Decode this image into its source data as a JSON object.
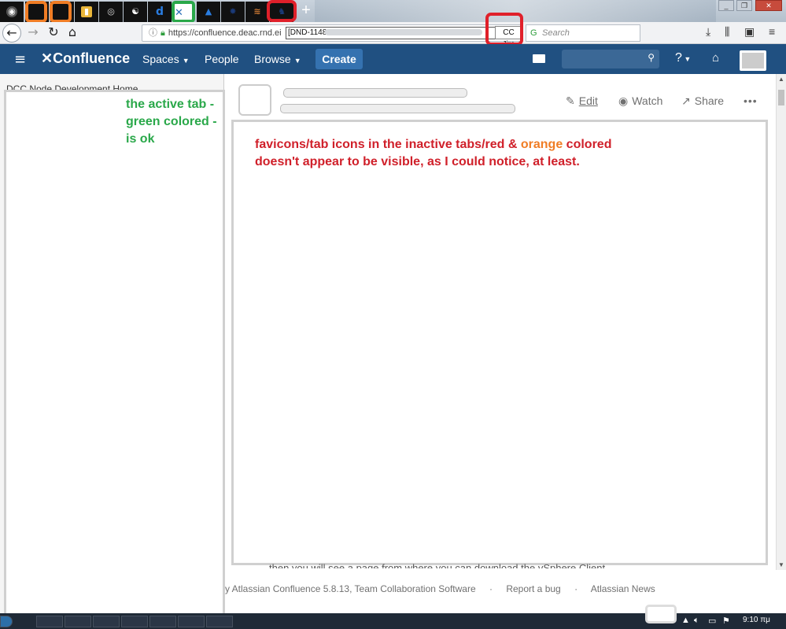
{
  "browser": {
    "url": "https://confluence.deac.rnd.ei",
    "url_overlay_title": "[DND-1148",
    "jira_pill": "CC Jira",
    "search_placeholder": "Search",
    "tabs": [
      {
        "icon": "globe-icon",
        "glyph": "◉",
        "color": "#9aa"
      },
      {
        "icon": "blank-tab-icon",
        "glyph": "",
        "color": "#111"
      },
      {
        "icon": "blank-tab-icon",
        "glyph": "",
        "color": "#111"
      },
      {
        "icon": "trello-icon",
        "glyph": "▮",
        "color": "#e9b63a"
      },
      {
        "icon": "swirl-icon",
        "glyph": "◎",
        "color": "#ddd"
      },
      {
        "icon": "yin-yang-icon",
        "glyph": "☯",
        "color": "#fff"
      },
      {
        "icon": "d-logo-icon",
        "glyph": "d",
        "color": "#2a7de1"
      },
      {
        "icon": "confluence-icon",
        "glyph": "✕",
        "color": "#2a6fb8"
      },
      {
        "icon": "atlassian-icon",
        "glyph": "▲",
        "color": "#2a7de1"
      },
      {
        "icon": "jira-dark-icon",
        "glyph": "✸",
        "color": "#1b3a78"
      },
      {
        "icon": "stack-icon",
        "glyph": "≋",
        "color": "#d07b34"
      },
      {
        "icon": "jira-icon",
        "glyph": "♞",
        "color": "#1b3a78"
      }
    ]
  },
  "confluence": {
    "logo": "✕Confluence",
    "menu": {
      "spaces": "Spaces",
      "people": "People",
      "browse": "Browse"
    },
    "create": "Create",
    "sidebar_crumb": "DCC Node Development Home",
    "actions": {
      "edit": "Edit",
      "watch": "Watch",
      "share": "Share",
      "more": "•••"
    },
    "body_text": "then you will see a page from where you can download the vSphere Client",
    "footer": {
      "powered": "y Atlassian Confluence 5.8.13, Team Collaboration Software",
      "sep": "·",
      "report": "Report a bug",
      "news": "Atlassian News"
    }
  },
  "annotations": {
    "green_note": "the active tab - green colored - is ok",
    "red_note_part1": "favicons/tab icons in the inactive tabs/red &",
    "red_note_orange": "orange",
    "red_note_part2": "colored doesn't appear to be visible, as I could notice, at least."
  },
  "taskbar": {
    "clock": "9:10 πμ"
  },
  "colors": {
    "confluence_header": "#205081",
    "create_button": "#3572b0",
    "annotation_red": "#d0202a",
    "annotation_orange": "#f07d25",
    "annotation_green": "#2aa84a"
  }
}
